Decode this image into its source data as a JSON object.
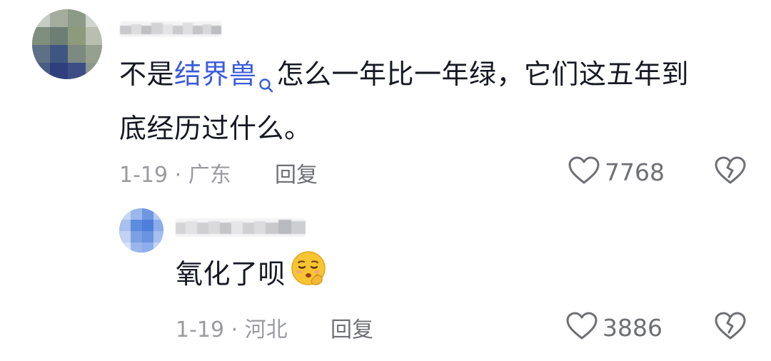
{
  "comment": {
    "text_prefix": "不是",
    "link_term": "结界兽",
    "text_rest_line1": "怎么一年比一年绿，它们这五年到",
    "text_line2": "底经历过什么。",
    "date": "1-19",
    "location": "广东",
    "reply_label": "回复",
    "like_count": "7768"
  },
  "reply": {
    "text": "氧化了呗",
    "emoji": "shushing-face-emoji",
    "date": "1-19",
    "location": "河北",
    "reply_label": "回复",
    "like_count": "3886"
  },
  "colors": {
    "link": "#3b5bdb",
    "text": "#161823",
    "meta": "#9a9ba0",
    "secondary": "#6f7075"
  },
  "icons": {
    "search": "search-icon",
    "like": "heart-outline-icon",
    "dislike": "broken-heart-icon"
  }
}
